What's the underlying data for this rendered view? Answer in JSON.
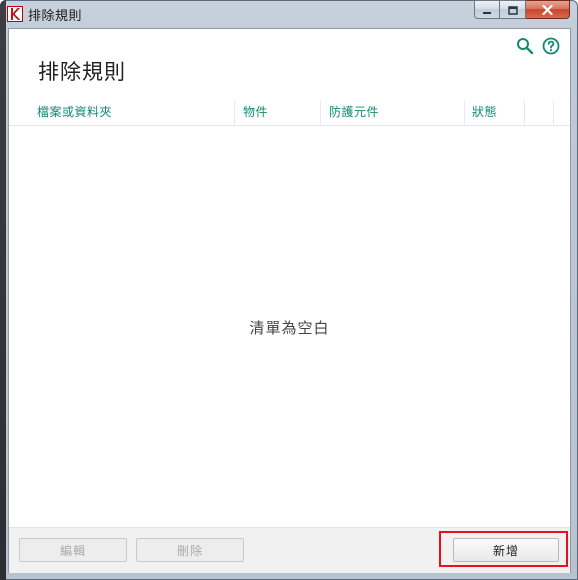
{
  "window": {
    "title": "排除規則"
  },
  "header": {
    "heading": "排除規則"
  },
  "table": {
    "columns": [
      "檔案或資料夾",
      "物件",
      "防護元件",
      "狀態"
    ],
    "empty_message": "清單為空白"
  },
  "footer": {
    "edit_label": "編輯",
    "delete_label": "刪除",
    "add_label": "新增"
  },
  "colors": {
    "accent": "#138a71",
    "highlight": "#e8101c"
  },
  "icons": [
    "app-logo-icon",
    "minimize-icon",
    "maximize-icon",
    "close-icon",
    "search-icon",
    "help-icon"
  ]
}
